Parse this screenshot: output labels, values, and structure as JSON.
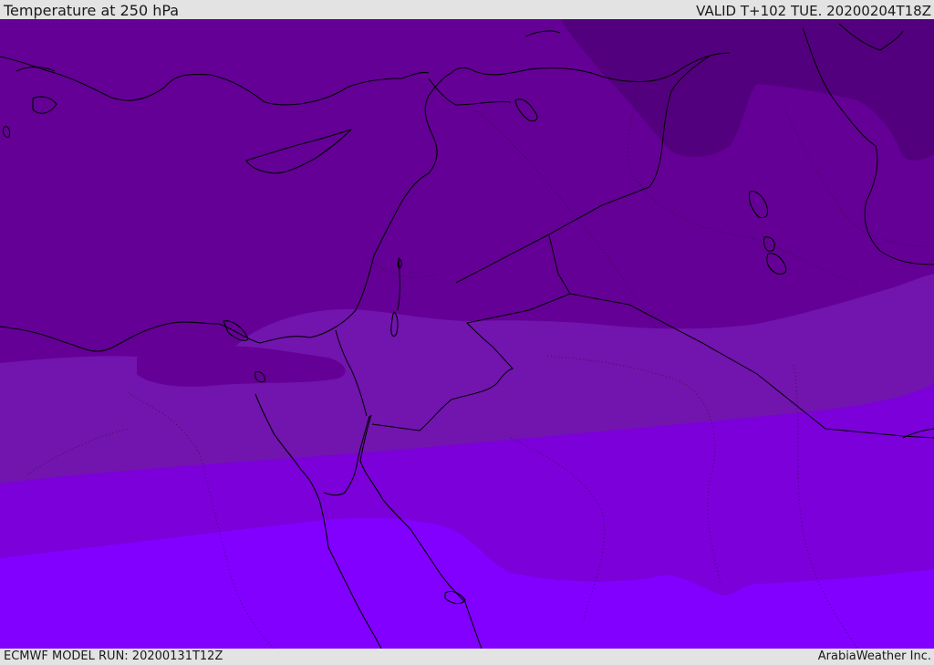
{
  "header": {
    "title": "Temperature at 250 hPa",
    "valid": "VALID T+102 TUE. 20200204T18Z"
  },
  "footer": {
    "model_run": "ECMWF MODEL RUN: 20200131T12Z",
    "credit": "ArabiaWeather Inc."
  },
  "colors": {
    "band_coldest": "#53007e",
    "band_cold": "#640096",
    "band_mid": "#7214ae",
    "band_warm": "#7b00d9",
    "band_warmest": "#8100ff",
    "border_line": "#000000"
  }
}
